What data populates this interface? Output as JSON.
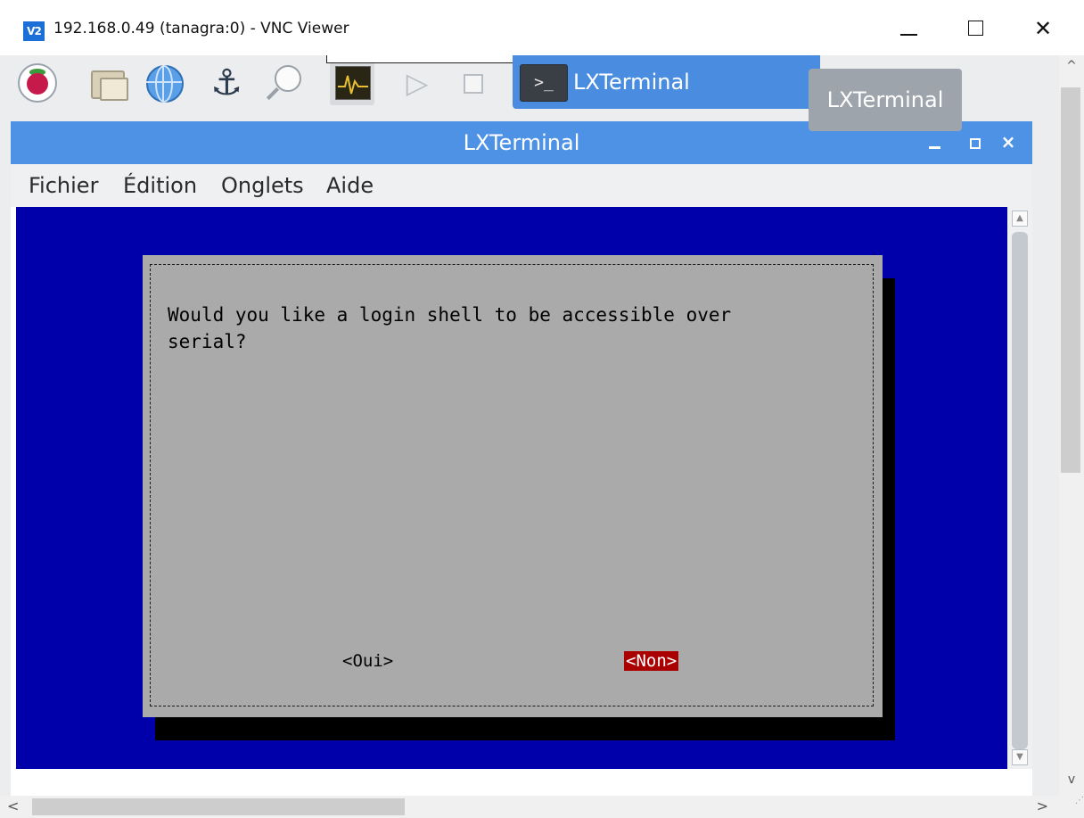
{
  "vnc": {
    "logo_text": "V2",
    "title": "192.168.0.49 (tanagra:0) - VNC Viewer",
    "controls": {
      "close_glyph": "✕"
    }
  },
  "taskbar": {
    "launchers": [
      "raspberry-menu-icon",
      "file-manager-icon",
      "web-browser-icon",
      "anchor-icon",
      "magnifier-icon",
      "system-monitor-icon",
      "play-icon",
      "stop-icon"
    ],
    "anchor_glyph": "⚓",
    "play_glyph": "▷",
    "task": {
      "icon_text": ">_",
      "label": "LXTerminal"
    }
  },
  "tooltip": {
    "text": "LXTerminal"
  },
  "lxterminal": {
    "title": "LXTerminal",
    "close_glyph": "×",
    "menu": [
      "Fichier",
      "Édition",
      "Onglets",
      "Aide"
    ]
  },
  "dialog": {
    "message": "Would you like a login shell to be accessible over\nserial?",
    "buttons": {
      "yes": "<Oui>",
      "no": "<Non>"
    },
    "selected": "no"
  },
  "scroll_glyphs": {
    "up": "^",
    "down": "v",
    "left": "<",
    "right": ">",
    "small_up": "▲",
    "small_down": "▼",
    "grip": "⋰"
  },
  "colors": {
    "terminal_bg": "#0000aa",
    "dialog_bg": "#aaaaaa",
    "selected_button_bg": "#aa0000",
    "lx_titlebar": "#4e92e6",
    "task_active": "#4a8de0"
  }
}
